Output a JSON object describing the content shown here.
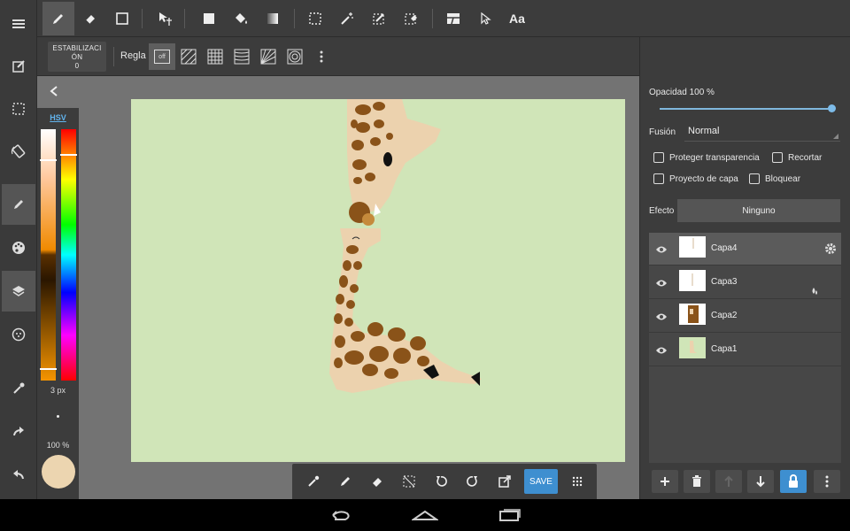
{
  "app": {
    "accent_color": "#3e8fd0",
    "current_color": "#ecd5b0"
  },
  "left_rail": {
    "items": [
      {
        "name": "menu-icon"
      },
      {
        "name": "edit-canvas-icon"
      },
      {
        "name": "selection-icon"
      },
      {
        "name": "rotate-screen-icon"
      },
      {
        "name": "pen-tool-icon"
      },
      {
        "name": "palette-icon"
      },
      {
        "name": "layers-icon"
      },
      {
        "name": "material-icon"
      },
      {
        "name": "eyedropper-icon"
      },
      {
        "name": "redo-icon"
      },
      {
        "name": "undo-icon"
      }
    ]
  },
  "top_toolbar": {
    "tools": [
      "pen-icon",
      "eraser-icon",
      "rectangle-icon",
      "move-icon",
      "fill-rect-icon",
      "bucket-icon",
      "gradient-icon",
      "select-rect-icon",
      "magic-wand-icon",
      "select-pen-icon",
      "select-eraser-icon",
      "panel-icon",
      "pointer-icon",
      "text-icon"
    ],
    "text_tool_label": "Aa"
  },
  "sub_toolbar": {
    "stabilizer_label": "ESTABILIZACI ÓN",
    "stabilizer_value": "0",
    "ruler_label": "Regla",
    "ruler_off_label": "off"
  },
  "color_panel": {
    "mode_label": "HSV",
    "brush_size": "3 px",
    "brush_opacity": "100 %"
  },
  "bottom_bar": {
    "save_label": "SAVE"
  },
  "layer_panel": {
    "opacity_label": "Opacidad 100 %",
    "opacity_value": 1.0,
    "blend_label": "Fusión",
    "blend_value": "Normal",
    "protect_transparency": "Proteger transparencia",
    "clipping": "Recortar",
    "layer_project": "Proyecto de capa",
    "lock": "Bloquear",
    "effect_label": "Efecto",
    "effect_value": "Ninguno",
    "layers": [
      {
        "name": "Capa4",
        "selected": true
      },
      {
        "name": "Capa3",
        "selected": false
      },
      {
        "name": "Capa2",
        "selected": false
      },
      {
        "name": "Capa1",
        "selected": false
      }
    ]
  }
}
